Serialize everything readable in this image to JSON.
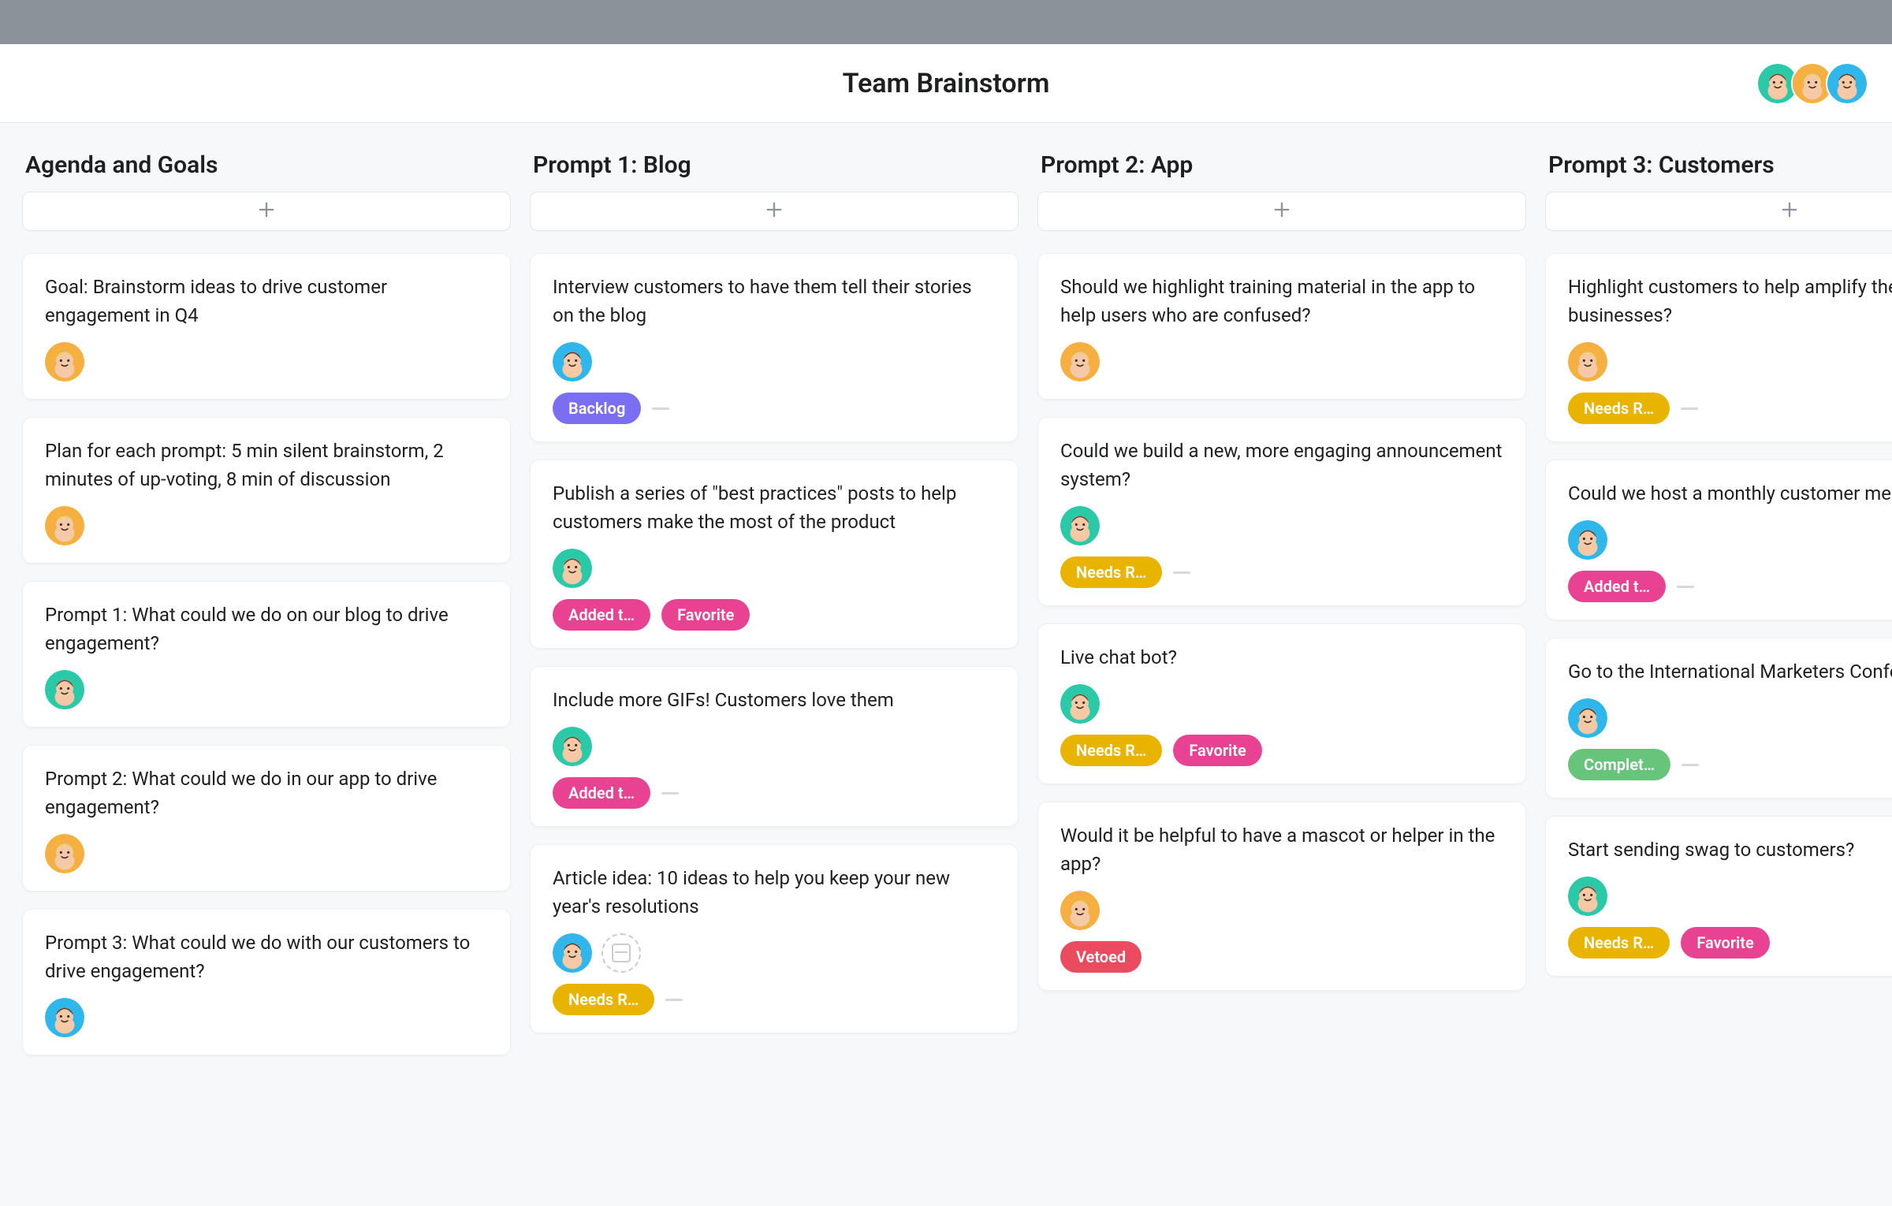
{
  "header": {
    "title": "Team Brainstorm",
    "avatars": [
      "green",
      "orange",
      "blue"
    ]
  },
  "tag_labels": {
    "backlog": "Backlog",
    "added": "Added t…",
    "favorite": "Favorite",
    "needs": "Needs R…",
    "vetoed": "Vetoed",
    "complete": "Complet…"
  },
  "columns": [
    {
      "title": "Agenda and Goals",
      "cards": [
        {
          "text": "Goal: Brainstorm ideas to drive customer engagement in Q4",
          "avatar": "orange"
        },
        {
          "text": "Plan for each prompt: 5 min silent brainstorm, 2 minutes of up-voting, 8 min of discussion",
          "avatar": "orange"
        },
        {
          "text": "Prompt 1: What could we do on our blog to drive engagement?",
          "avatar": "green"
        },
        {
          "text": "Prompt 2: What could we do in our app to drive engagement?",
          "avatar": "orange"
        },
        {
          "text": "Prompt 3: What could we do with our customers to drive engagement?",
          "avatar": "blue"
        }
      ]
    },
    {
      "title": "Prompt 1: Blog",
      "cards": [
        {
          "text": "Interview customers to have them tell their stories on the blog",
          "avatar": "blue",
          "tags": [
            "backlog"
          ],
          "dash": true
        },
        {
          "text": "Publish a series of \"best practices\" posts to help customers make the most of the product",
          "avatar": "green",
          "tags": [
            "added",
            "favorite"
          ]
        },
        {
          "text": "Include more GIFs! Customers love them",
          "avatar": "green",
          "tags": [
            "added"
          ],
          "dash": true
        },
        {
          "text": "Article idea: 10 ideas to help you keep your new year's resolutions",
          "avatar": "blue",
          "extra_icon": true,
          "tags": [
            "needs"
          ],
          "dash": true
        }
      ]
    },
    {
      "title": "Prompt 2: App",
      "cards": [
        {
          "text": "Should we highlight training material in the app to help users who are confused?",
          "avatar": "orange"
        },
        {
          "text": "Could we build a new, more engaging announcement system?",
          "avatar": "green",
          "tags": [
            "needs"
          ],
          "dash": true
        },
        {
          "text": "Live chat bot?",
          "avatar": "green",
          "tags": [
            "needs",
            "favorite"
          ]
        },
        {
          "text": "Would it be helpful to have a mascot or helper in the app?",
          "avatar": "orange",
          "tags": [
            "vetoed"
          ]
        }
      ]
    },
    {
      "title": "Prompt 3: Customers",
      "cards": [
        {
          "text": "Highlight customers to help amplify their businesses?",
          "avatar": "orange",
          "tags": [
            "needs"
          ],
          "dash": true
        },
        {
          "text": "Could we host a monthly customer meet up?",
          "avatar": "blue",
          "tags": [
            "added"
          ],
          "dash": true
        },
        {
          "text": "Go to the International Marketers Conference?",
          "avatar": "blue",
          "tags": [
            "complete"
          ],
          "dash": true
        },
        {
          "text": "Start sending swag to customers?",
          "avatar": "green",
          "tags": [
            "needs",
            "favorite"
          ]
        }
      ]
    }
  ]
}
